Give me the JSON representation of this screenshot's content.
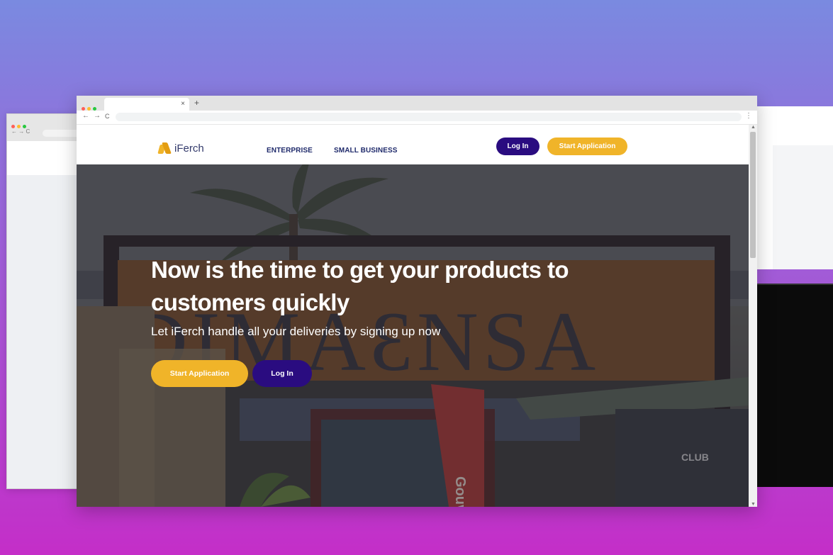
{
  "browser": {
    "tab_close": "×",
    "new_tab": "+",
    "nav_back": "←",
    "nav_forward": "→",
    "nav_reload": "C",
    "menu": "⋮"
  },
  "site": {
    "logo_text": "iFerch",
    "nav": [
      "ENTERPRISE",
      "SMALL BUSINESS"
    ],
    "login_label": "Log In",
    "start_label": "Start Application"
  },
  "hero": {
    "title": "Now is the time to get your products to customers quickly",
    "subtitle": "Let iFerch handle all your deliveries by signing up now",
    "primary_cta": "Start Application",
    "secondary_cta": "Log In",
    "sign_text": "DIMAƐNSA",
    "flag_text": "Gouvernor",
    "club_text": "CLUB"
  },
  "colors": {
    "brand_purple": "#2a0c80",
    "brand_yellow": "#f0b429",
    "background_top": "#7a8ae0",
    "background_bottom": "#c42ec8"
  }
}
